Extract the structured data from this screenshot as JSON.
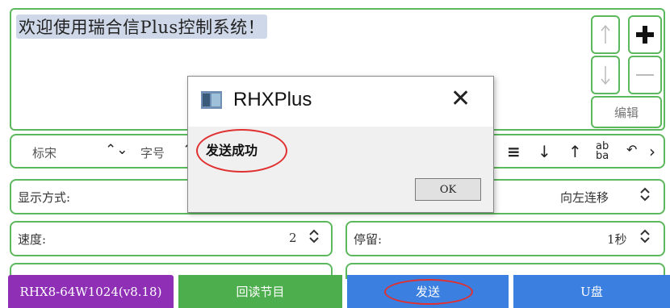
{
  "editor": {
    "text": "欢迎使用瑞合信Plus控制系统！",
    "up_icon": "arrow-up-icon",
    "plus_icon": "plus-icon",
    "down_icon": "arrow-down-icon",
    "minus_icon": "minus-icon",
    "edit_label": "编辑"
  },
  "toolbar": {
    "font_value": "标宋",
    "font_size_label": "字号"
  },
  "display": {
    "label": "显示方式:",
    "value": "向左连移"
  },
  "speed": {
    "label": "速度:",
    "value": "2"
  },
  "stay": {
    "label": "停留:",
    "value": "1秒"
  },
  "bottom": {
    "device": "RHX8-64W1024(v8.18)",
    "readback": "回读节目",
    "send": "发送",
    "udisk": "U盘"
  },
  "dialog": {
    "title": "RHXPlus",
    "message": "发送成功",
    "ok_label": "OK"
  },
  "colors": {
    "green": "#5cb85c",
    "purple": "#8e2fb5",
    "blue": "#3b7fe0",
    "annotation": "#e03030"
  }
}
